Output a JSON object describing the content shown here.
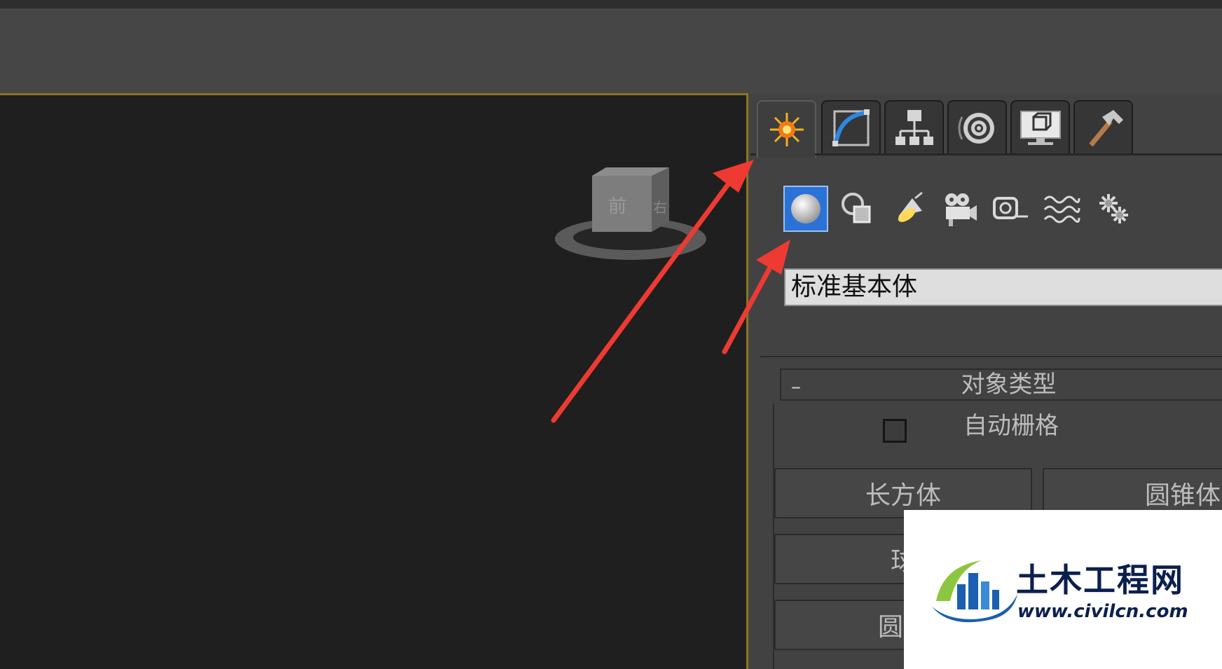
{
  "panel": {
    "tabs": [
      "create-icon",
      "modify-icon",
      "hierarchy-icon",
      "motion-icon",
      "display-icon",
      "utilities-icon"
    ],
    "subcategories": [
      "geometry-icon",
      "shapes-icon",
      "lights-icon",
      "cameras-icon",
      "helpers-icon",
      "space-warps-icon",
      "systems-icon"
    ],
    "dropdown_value": "标准基本体",
    "rollout": {
      "collapse_symbol": "–",
      "title": "对象类型",
      "autogrid_label": "自动栅格",
      "buttons": [
        "长方体",
        "圆锥体",
        "球",
        "圆柱"
      ]
    }
  },
  "watermark": {
    "title": "土木工程网",
    "url": "www.civilcn.com"
  },
  "colors": {
    "annotation_arrow": "#ee3a32",
    "viewport_border": "#8a7422",
    "active_subicon": "#2b72d6"
  }
}
